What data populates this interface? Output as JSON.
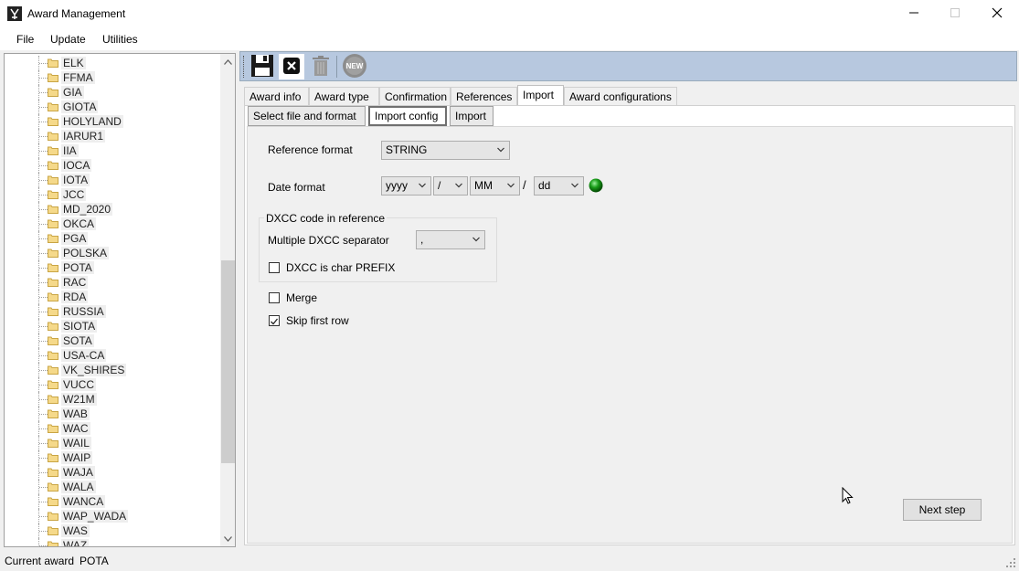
{
  "window": {
    "title": "Award Management",
    "minimize_icon": "minimize-icon",
    "maximize_icon": "maximize-icon",
    "close_icon": "close-icon"
  },
  "menu": {
    "items": [
      {
        "label": "File"
      },
      {
        "label": "Update"
      },
      {
        "label": "Utilities"
      }
    ]
  },
  "tree": {
    "items": [
      "ELK",
      "FFMA",
      "GIA",
      "GIOTA",
      "HOLYLAND",
      "IARUR1",
      "IIA",
      "IOCA",
      "IOTA",
      "JCC",
      "MD_2020",
      "OKCA",
      "PGA",
      "POLSKA",
      "POTA",
      "RAC",
      "RDA",
      "RUSSIA",
      "SIOTA",
      "SOTA",
      "USA-CA",
      "VK_SHIRES",
      "VUCC",
      "W21M",
      "WAB",
      "WAC",
      "WAIL",
      "WAIP",
      "WAJA",
      "WALA",
      "WANCA",
      "WAP_WADA",
      "WAS",
      "WAZ"
    ],
    "scroll_position": 0.42
  },
  "toolbar": {
    "buttons": [
      {
        "name": "save-icon"
      },
      {
        "name": "close-icon"
      },
      {
        "name": "trash-icon"
      },
      {
        "name": "new-icon",
        "label": "NEW"
      }
    ]
  },
  "tabs": [
    {
      "label": "Award info"
    },
    {
      "label": "Award type"
    },
    {
      "label": "Confirmation"
    },
    {
      "label": "References"
    },
    {
      "label": "Import",
      "active": true
    },
    {
      "label": "Award configurations"
    }
  ],
  "subtabs": [
    {
      "label": "Select file and format"
    },
    {
      "label": "Import config",
      "active": true
    },
    {
      "label": "Import"
    }
  ],
  "form": {
    "reference_format_label": "Reference format",
    "reference_format_value": "STRING",
    "date_format_label": "Date format",
    "date_parts": [
      "yyyy",
      "/",
      "MM",
      "dd"
    ],
    "date_separator_text": "/",
    "status_led_color": "#1a9e1a",
    "dxcc_group_label": "DXCC code in reference",
    "dxcc_separator_label": "Multiple DXCC separator",
    "dxcc_separator_value": ",",
    "dxcc_prefix_label": "DXCC is char PREFIX",
    "dxcc_prefix_checked": false,
    "merge_label": "Merge",
    "merge_checked": false,
    "skip_first_row_label": "Skip first row",
    "skip_first_row_checked": true,
    "next_step_label": "Next step"
  },
  "status": {
    "current_award_label": "Current award",
    "current_award_value": "POTA"
  }
}
